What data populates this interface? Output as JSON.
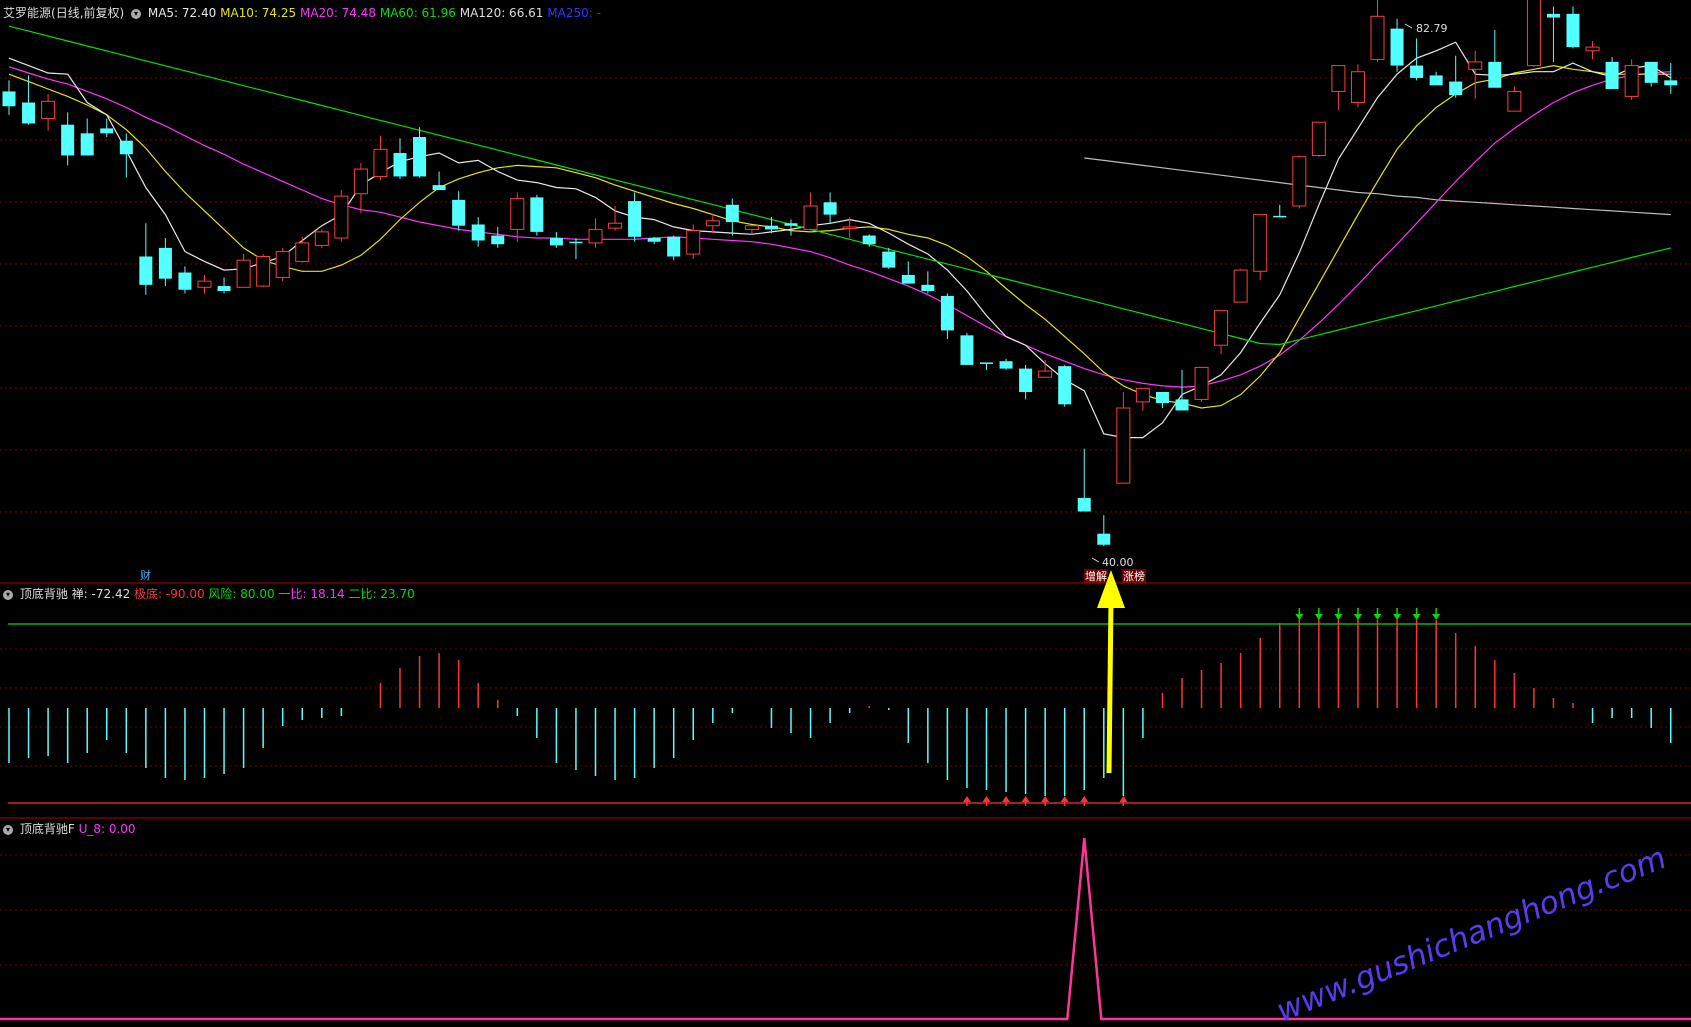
{
  "colors": {
    "up": "#ff3b3b",
    "down": "#54ffff",
    "ma5": "#e8e8e8",
    "ma10": "#e6e600",
    "ma20": "#ff33ff",
    "ma60": "#00e000",
    "ma120": "#bbbbbb",
    "ma250": "#3333ff",
    "grid": "#7a0000",
    "pane_border": "#b40000",
    "osc_green": "#00dd00",
    "osc_red": "#ff3333",
    "bottom_line": "#ff3399",
    "arrow": "#ffff00",
    "watermark": "#5a3cf0"
  },
  "main_pane": {
    "stock_name": "艾罗能源",
    "period": "(日线,前复权)",
    "ma_labels": [
      "MA5: 72.40",
      "MA10: 74.25",
      "MA20: 74.48",
      "MA60: 61.96",
      "MA120: 66.61",
      "MA250: -"
    ],
    "high_label": "82.79",
    "low_label": "40.00",
    "cai_marker": "财",
    "tag_zengjian": "增解",
    "tag_zhangting": "涨榜"
  },
  "osc_pane": {
    "title": "顶底背驰",
    "labels": [
      "禅: -72.42",
      "极底: -90.00",
      "风险: 80.00",
      "一比: 18.14",
      "二比: 23.70"
    ]
  },
  "bottom_pane": {
    "title": "顶底背驰F",
    "label": "U_8: 0.00"
  },
  "watermark": "www.gushichanghong.com",
  "chart_data": {
    "type": "candlestick",
    "price_range": [
      40,
      84
    ],
    "ohlc": [
      [
        78.2,
        79.1,
        76.3,
        77.0
      ],
      [
        77.3,
        79.5,
        75.5,
        75.6
      ],
      [
        76.0,
        78.0,
        75.0,
        77.4
      ],
      [
        75.5,
        76.5,
        72.2,
        73.0
      ],
      [
        74.8,
        76.0,
        73.5,
        73.0
      ],
      [
        75.2,
        76.0,
        74.5,
        74.8
      ],
      [
        74.2,
        74.8,
        71.2,
        73.1
      ],
      [
        64.8,
        67.5,
        61.7,
        62.5
      ],
      [
        65.5,
        66.3,
        62.4,
        63.0
      ],
      [
        63.5,
        64.0,
        61.8,
        62.1
      ],
      [
        62.3,
        63.3,
        61.8,
        62.8
      ],
      [
        62.4,
        63.1,
        61.8,
        62.0
      ],
      [
        62.3,
        65.0,
        62.4,
        64.5
      ],
      [
        62.4,
        65.0,
        62.3,
        64.8
      ],
      [
        63.1,
        65.5,
        62.8,
        65.2
      ],
      [
        64.4,
        66.4,
        64.3,
        65.9
      ],
      [
        65.7,
        67.0,
        65.5,
        66.8
      ],
      [
        66.3,
        70.2,
        66.0,
        69.7
      ],
      [
        69.9,
        72.4,
        68.3,
        71.9
      ],
      [
        71.3,
        74.6,
        71.0,
        73.5
      ],
      [
        73.2,
        74.4,
        71.1,
        71.3
      ],
      [
        74.5,
        75.3,
        71.2,
        71.3
      ],
      [
        70.6,
        71.7,
        70.2,
        70.2
      ],
      [
        69.4,
        70.1,
        66.9,
        67.3
      ],
      [
        67.4,
        68.0,
        65.6,
        66.1
      ],
      [
        66.5,
        67.2,
        65.5,
        65.8
      ],
      [
        67.0,
        70.0,
        66.0,
        69.5
      ],
      [
        69.6,
        69.8,
        66.5,
        66.8
      ],
      [
        66.3,
        66.8,
        65.5,
        65.7
      ],
      [
        66.0,
        66.3,
        64.6,
        65.9
      ],
      [
        65.9,
        67.9,
        65.5,
        67.0
      ],
      [
        67.1,
        68.9,
        66.9,
        67.5
      ],
      [
        69.3,
        70.0,
        66.0,
        66.4
      ],
      [
        66.3,
        66.4,
        65.8,
        66.0
      ],
      [
        66.4,
        66.5,
        64.5,
        64.8
      ],
      [
        65.0,
        67.4,
        64.6,
        66.9
      ],
      [
        67.3,
        68.3,
        66.7,
        67.7
      ],
      [
        69.0,
        69.5,
        66.5,
        67.6
      ],
      [
        67.0,
        67.3,
        66.6,
        67.3
      ],
      [
        67.3,
        68.0,
        66.7,
        67.0
      ],
      [
        67.5,
        67.8,
        66.5,
        67.3
      ],
      [
        67.0,
        70.0,
        66.9,
        68.9
      ],
      [
        69.2,
        70.0,
        67.5,
        68.2
      ],
      [
        67.2,
        68.0,
        66.3,
        67.2
      ],
      [
        66.5,
        66.6,
        65.6,
        65.8
      ],
      [
        65.2,
        65.5,
        63.8,
        63.9
      ],
      [
        63.3,
        64.4,
        62.6,
        62.6
      ],
      [
        62.5,
        63.6,
        61.8,
        62.0
      ],
      [
        61.6,
        61.8,
        58.1,
        58.8
      ],
      [
        58.4,
        58.6,
        56.0,
        56.0
      ],
      [
        56.2,
        56.2,
        55.6,
        56.1
      ],
      [
        56.3,
        56.5,
        55.6,
        55.7
      ],
      [
        55.7,
        56.0,
        53.2,
        53.8
      ],
      [
        55.0,
        56.4,
        55.0,
        55.5
      ],
      [
        55.9,
        56.0,
        52.6,
        52.8
      ],
      [
        45.2,
        49.2,
        44.9,
        44.1
      ],
      [
        42.3,
        43.8,
        41.3,
        41.4
      ],
      [
        46.4,
        53.8,
        46.4,
        52.5
      ],
      [
        53.0,
        54.1,
        52.3,
        54.1
      ],
      [
        53.8,
        53.7,
        52.5,
        52.9
      ],
      [
        53.2,
        55.6,
        52.3,
        52.3
      ],
      [
        53.2,
        55.6,
        53.0,
        55.8
      ],
      [
        57.6,
        59.3,
        56.9,
        60.4
      ],
      [
        61.1,
        63.8,
        61.1,
        63.7
      ],
      [
        63.6,
        67.8,
        62.9,
        68.2
      ],
      [
        68.1,
        69.0,
        68.0,
        68.0
      ],
      [
        68.9,
        73.0,
        68.7,
        72.9
      ],
      [
        73.0,
        75.6,
        72.9,
        75.7
      ],
      [
        78.2,
        79.5,
        76.7,
        80.3
      ],
      [
        77.3,
        80.4,
        76.9,
        79.8
      ],
      [
        80.8,
        85.7,
        80.6,
        84.3
      ],
      [
        83.3,
        84.1,
        79.8,
        80.3
      ],
      [
        80.3,
        82.5,
        79.1,
        79.3
      ],
      [
        79.5,
        79.8,
        78.7,
        78.7
      ],
      [
        79.0,
        81.1,
        77.7,
        77.9
      ],
      [
        80.0,
        81.5,
        77.6,
        80.6
      ],
      [
        80.6,
        83.2,
        79.0,
        78.5
      ],
      [
        76.6,
        78.6,
        76.8,
        78.2
      ],
      [
        80.3,
        83.9,
        80.2,
        85.7
      ],
      [
        84.5,
        85.1,
        80.6,
        84.2
      ],
      [
        84.5,
        85.1,
        81.7,
        81.8
      ],
      [
        81.5,
        82.3,
        80.8,
        81.8
      ],
      [
        80.6,
        81.0,
        78.5,
        78.4
      ],
      [
        77.8,
        80.8,
        77.5,
        80.3
      ],
      [
        80.6,
        80.4,
        78.6,
        78.9
      ],
      [
        79.1,
        80.5,
        78.0,
        78.7
      ]
    ],
    "ma5": [
      80.9,
      80.3,
      79.7,
      79.6,
      77.3,
      76.3,
      73.4,
      70.4,
      68.2,
      65.2,
      64.4,
      63.7,
      63.8,
      64.3,
      64.8,
      66.1,
      67.3,
      68.2,
      70.6,
      71.6,
      72.5,
      72.9,
      73.2,
      72.4,
      72.6,
      71.7,
      71.0,
      70.8,
      70.4,
      70.3,
      69.6,
      68.5,
      68.0,
      67.8,
      67.2,
      66.9,
      66.8,
      66.7,
      66.6,
      66.8,
      67.0,
      67.3,
      67.5,
      67.8,
      67.5,
      66.7,
      65.8,
      65.0,
      63.7,
      62.0,
      60.0,
      58.3,
      57.6,
      56.1,
      54.8,
      53.9,
      50.4,
      50.1,
      50.1,
      51.3,
      53.6,
      54.3,
      55.2,
      57.0,
      59.4,
      61.7,
      65.1,
      69.0,
      72.7,
      75.2,
      77.7,
      79.6,
      80.9,
      81.5,
      82.2,
      79.6,
      79.5,
      79.6,
      79.8,
      79.8,
      80.5,
      79.8,
      79.4,
      80.1,
      80.3,
      79.3
    ],
    "ma10": [
      79.6,
      79.0,
      78.4,
      77.8,
      77.1,
      76.3,
      75.1,
      73.6,
      71.7,
      70.0,
      68.5,
      67.0,
      65.5,
      64.5,
      64.0,
      63.6,
      63.6,
      64.1,
      64.9,
      66.2,
      67.8,
      69.2,
      70.4,
      71.1,
      71.6,
      72.0,
      72.2,
      72.1,
      72.0,
      71.6,
      71.2,
      70.6,
      70.1,
      69.6,
      69.1,
      68.7,
      68.2,
      67.7,
      67.4,
      67.2,
      66.9,
      66.8,
      66.9,
      67.1,
      67.2,
      67.0,
      66.6,
      66.3,
      65.7,
      64.8,
      63.6,
      62.2,
      60.9,
      59.7,
      58.3,
      56.9,
      55.4,
      54.3,
      53.6,
      53.1,
      52.9,
      52.5,
      52.7,
      53.6,
      55.1,
      57.0,
      59.8,
      62.6,
      65.4,
      68.2,
      70.9,
      73.5,
      75.4,
      76.9,
      78.0,
      78.9,
      79.2,
      79.7,
      80.0,
      80.3,
      80.0,
      79.8,
      79.6,
      79.6,
      79.6,
      79.6
    ],
    "ma20": [
      80.2,
      79.7,
      79.2,
      78.8,
      78.2,
      77.6,
      76.9,
      76.1,
      75.4,
      74.6,
      73.8,
      73.1,
      72.3,
      71.6,
      70.9,
      70.2,
      69.5,
      69.0,
      68.6,
      68.4,
      68.0,
      67.6,
      67.3,
      67.0,
      66.8,
      66.6,
      66.4,
      66.3,
      66.3,
      66.2,
      66.2,
      66.2,
      66.2,
      66.3,
      66.4,
      66.3,
      66.2,
      66.1,
      66.0,
      65.8,
      65.5,
      65.2,
      64.7,
      64.1,
      63.6,
      63.0,
      62.4,
      61.7,
      60.9,
      60.0,
      59.1,
      58.3,
      57.6,
      56.9,
      56.3,
      55.7,
      55.2,
      54.8,
      54.5,
      54.3,
      54.2,
      54.3,
      54.7,
      55.2,
      55.9,
      56.8,
      58.0,
      59.4,
      60.9,
      62.5,
      64.2,
      65.8,
      67.5,
      69.2,
      70.9,
      72.5,
      74.0,
      75.2,
      76.3,
      77.3,
      78.1,
      78.7,
      79.2,
      79.5,
      79.7,
      79.8
    ],
    "ma60": [
      null,
      null,
      null,
      null,
      null,
      null,
      null,
      null,
      null,
      null,
      null,
      null,
      null,
      null,
      null,
      null,
      null,
      null,
      null,
      null,
      null,
      null,
      null,
      null,
      null,
      null,
      null,
      null,
      null,
      null,
      null,
      null,
      null,
      null,
      null,
      null,
      null,
      null,
      null,
      null,
      null,
      null,
      null,
      null,
      null,
      null,
      null,
      null,
      null,
      null,
      null,
      null,
      null,
      null,
      null,
      null,
      null,
      null,
      null,
      null,
      null,
      null,
      null,
      null,
      null,
      null,
      null,
      null,
      null,
      null,
      null,
      null,
      null,
      null,
      null,
      null,
      null,
      null,
      null,
      null,
      null,
      null,
      null,
      null,
      null,
      null
    ],
    "ma120": [
      null,
      null,
      null,
      null,
      null,
      null,
      null,
      null,
      null,
      null,
      null,
      null,
      null,
      null,
      null,
      null,
      null,
      null,
      null,
      null,
      null,
      null,
      null,
      null,
      null,
      null,
      null,
      null,
      null,
      null,
      null,
      null,
      null,
      null,
      null,
      null,
      null,
      null,
      null,
      null,
      null,
      null,
      null,
      null,
      null,
      null,
      null,
      null,
      null,
      null,
      null,
      null,
      null,
      null,
      null,
      72.8,
      72.6,
      72.4,
      72.2,
      72.0,
      71.8,
      71.6,
      71.4,
      71.2,
      71.0,
      70.8,
      70.6,
      70.4,
      70.2,
      70.0,
      69.9,
      69.7,
      69.6,
      69.4,
      69.3,
      69.2,
      69.1,
      69.0,
      68.9,
      68.8,
      68.7,
      68.6,
      68.5,
      68.4,
      68.3,
      68.2
    ],
    "osc": [
      -55,
      -50,
      -48,
      -55,
      -45,
      -32,
      -45,
      -60,
      -70,
      -72,
      -70,
      -66,
      -60,
      -40,
      -18,
      -12,
      -10,
      -8,
      0,
      25,
      40,
      52,
      55,
      48,
      25,
      8,
      -8,
      -30,
      -55,
      -62,
      -68,
      -72,
      -70,
      -60,
      -50,
      -32,
      -15,
      -5,
      0,
      -20,
      -25,
      -30,
      -15,
      -5,
      2,
      -2,
      -35,
      -55,
      -72,
      -80,
      -82,
      -84,
      -86,
      -88,
      -88,
      -82,
      -70,
      -88,
      -30,
      15,
      30,
      38,
      45,
      55,
      70,
      85,
      95,
      95,
      90,
      92,
      88,
      90,
      92,
      88,
      75,
      62,
      48,
      35,
      20,
      10,
      5,
      -15,
      -10,
      -10,
      -20,
      -35
    ],
    "bottom_spike": [
      0,
      0,
      0,
      0,
      0,
      0,
      0,
      0,
      0,
      0,
      0,
      0,
      0,
      0,
      0,
      0,
      0,
      0,
      0,
      0,
      0,
      0,
      0,
      0,
      0,
      0,
      0,
      0,
      0,
      0,
      0,
      0,
      0,
      0,
      0,
      0,
      0,
      0,
      0,
      0,
      0,
      0,
      0,
      0,
      0,
      0,
      0,
      0,
      0,
      0,
      0,
      0,
      0,
      0,
      0,
      1,
      0,
      0,
      0,
      0,
      0,
      0,
      0,
      0,
      0,
      0,
      0,
      0,
      0,
      0,
      0,
      0,
      0,
      0,
      0,
      0,
      0,
      0,
      0,
      0,
      0,
      0,
      0,
      0,
      0,
      0
    ]
  }
}
